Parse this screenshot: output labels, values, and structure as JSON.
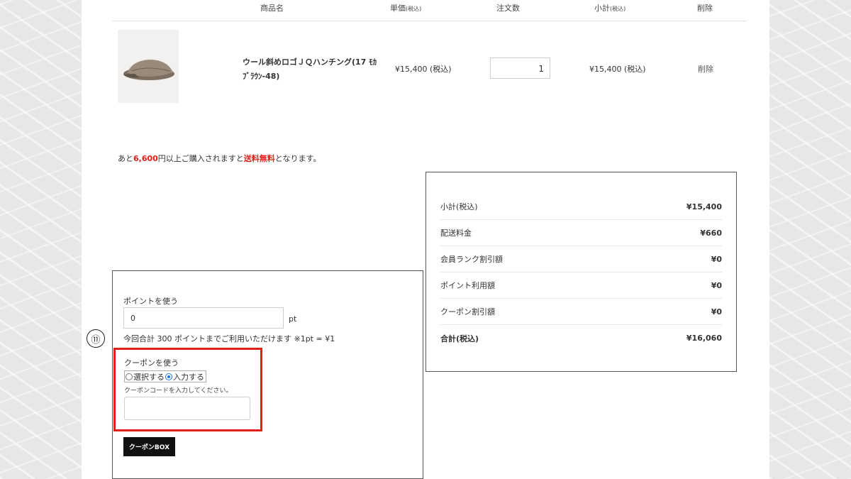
{
  "cart_header": {
    "product_name": "商品名",
    "unit_price": "単価",
    "unit_price_note": "(税込)",
    "quantity": "注文数",
    "subtotal": "小計",
    "subtotal_note": "(税込)",
    "delete": "削除"
  },
  "cart_item": {
    "name_line1": "ウール斜めロゴＪＱハンチング(17 ﾓｶ",
    "name_line2": "ﾌﾞﾗｳﾝ-48)",
    "price": "¥15,400 (税込)",
    "quantity": "1",
    "subtotal": "¥15,400 (税込)",
    "delete": "削除"
  },
  "shipping_message": {
    "prefix": "あと",
    "amount": "6,600",
    "middle": "円以上ご購入されますと",
    "highlight": "送料無料",
    "suffix": "となります。"
  },
  "summary": {
    "rows": [
      {
        "label": "小計(税込)",
        "value": "¥15,400"
      },
      {
        "label": "配送料金",
        "value": "¥660"
      },
      {
        "label": "会員ランク割引額",
        "value": "¥0"
      },
      {
        "label": "ポイント利用額",
        "value": "¥0"
      },
      {
        "label": "クーポン割引額",
        "value": "¥0"
      }
    ],
    "total_label": "合計(税込)",
    "total_value": "¥16,060"
  },
  "points": {
    "label": "ポイントを使う",
    "value": "0",
    "unit": "pt",
    "note": "今回合計 300 ポイントまでご利用いただけます ※1pt = ¥1"
  },
  "coupon": {
    "label": "クーポンを使う",
    "option_select": "選択する",
    "option_input": "入力する",
    "selected": "入力する",
    "hint": "クーポンコードを入力してください。",
    "code_value": "",
    "button_label": "クーポンBOX"
  },
  "step_marker": "⑪",
  "colors": {
    "highlight_red": "#e0201b",
    "radio_blue": "#1a73e8",
    "button_black": "#111111"
  }
}
